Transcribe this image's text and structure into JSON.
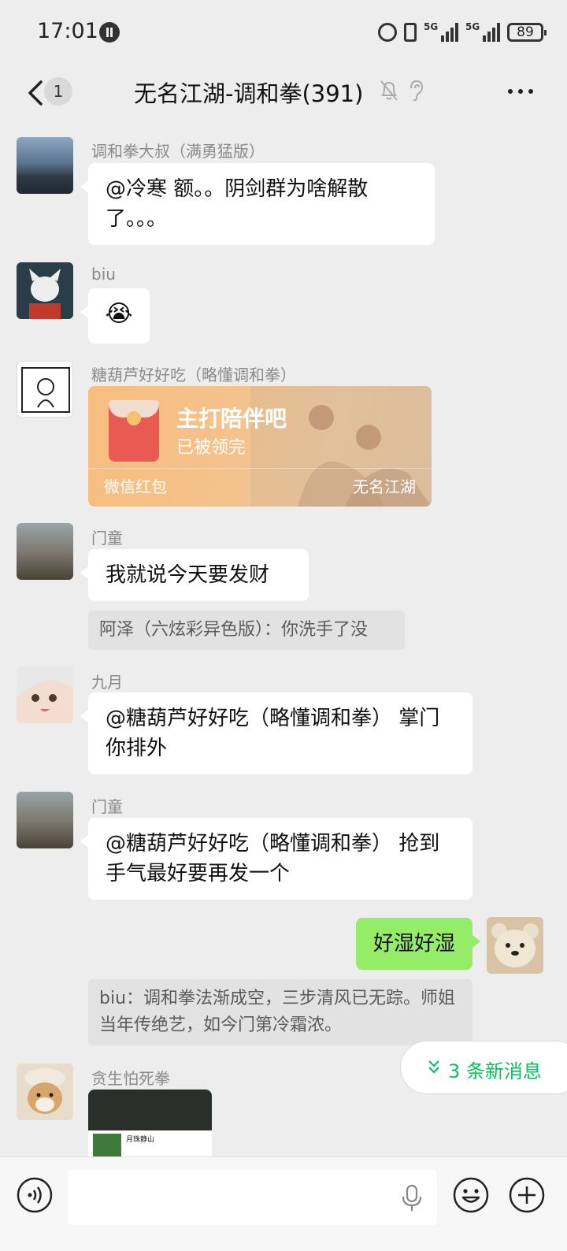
{
  "status_bar": {
    "time": "17:01",
    "network_1": "5G",
    "network_2": "5G",
    "battery": "89"
  },
  "header": {
    "unread_count": "1",
    "title": "无名江湖-调和拳(391)"
  },
  "messages": [
    {
      "sender": "调和拳大叔（满勇猛版）",
      "text": "@冷寒  额。。阴剑群为啥解散了。。。"
    },
    {
      "sender": "biu",
      "emoji": "😭"
    },
    {
      "sender": "糖葫芦好好吃（略懂调和拳）",
      "red_packet": {
        "title": "主打陪伴吧",
        "status": "已被领完",
        "label": "微信红包",
        "brand": "无名江湖"
      }
    },
    {
      "sender": "门童",
      "text": "我就说今天要发财",
      "quote": "阿泽（六炫彩异色版）：你洗手了没"
    },
    {
      "sender": "九月",
      "text": "@糖葫芦好好吃（略懂调和拳） 掌门你排外"
    },
    {
      "sender": "门童",
      "text": "@糖葫芦好好吃（略懂调和拳） 抢到手气最好要再发一个"
    },
    {
      "sender": "me",
      "text": "好湿好湿",
      "quote": "biu：调和拳法渐成空，三步清风已无踪。师姐当年传绝艺，如今门第冷霜浓。"
    },
    {
      "sender": "贪生怕死拳",
      "image_caption": "月珠静山"
    }
  ],
  "new_messages_pill": "3 条新消息",
  "input": {
    "value": "",
    "placeholder": ""
  },
  "colors": {
    "accent": "#07c160",
    "my_bubble": "#95ec69",
    "background": "#ededed"
  }
}
